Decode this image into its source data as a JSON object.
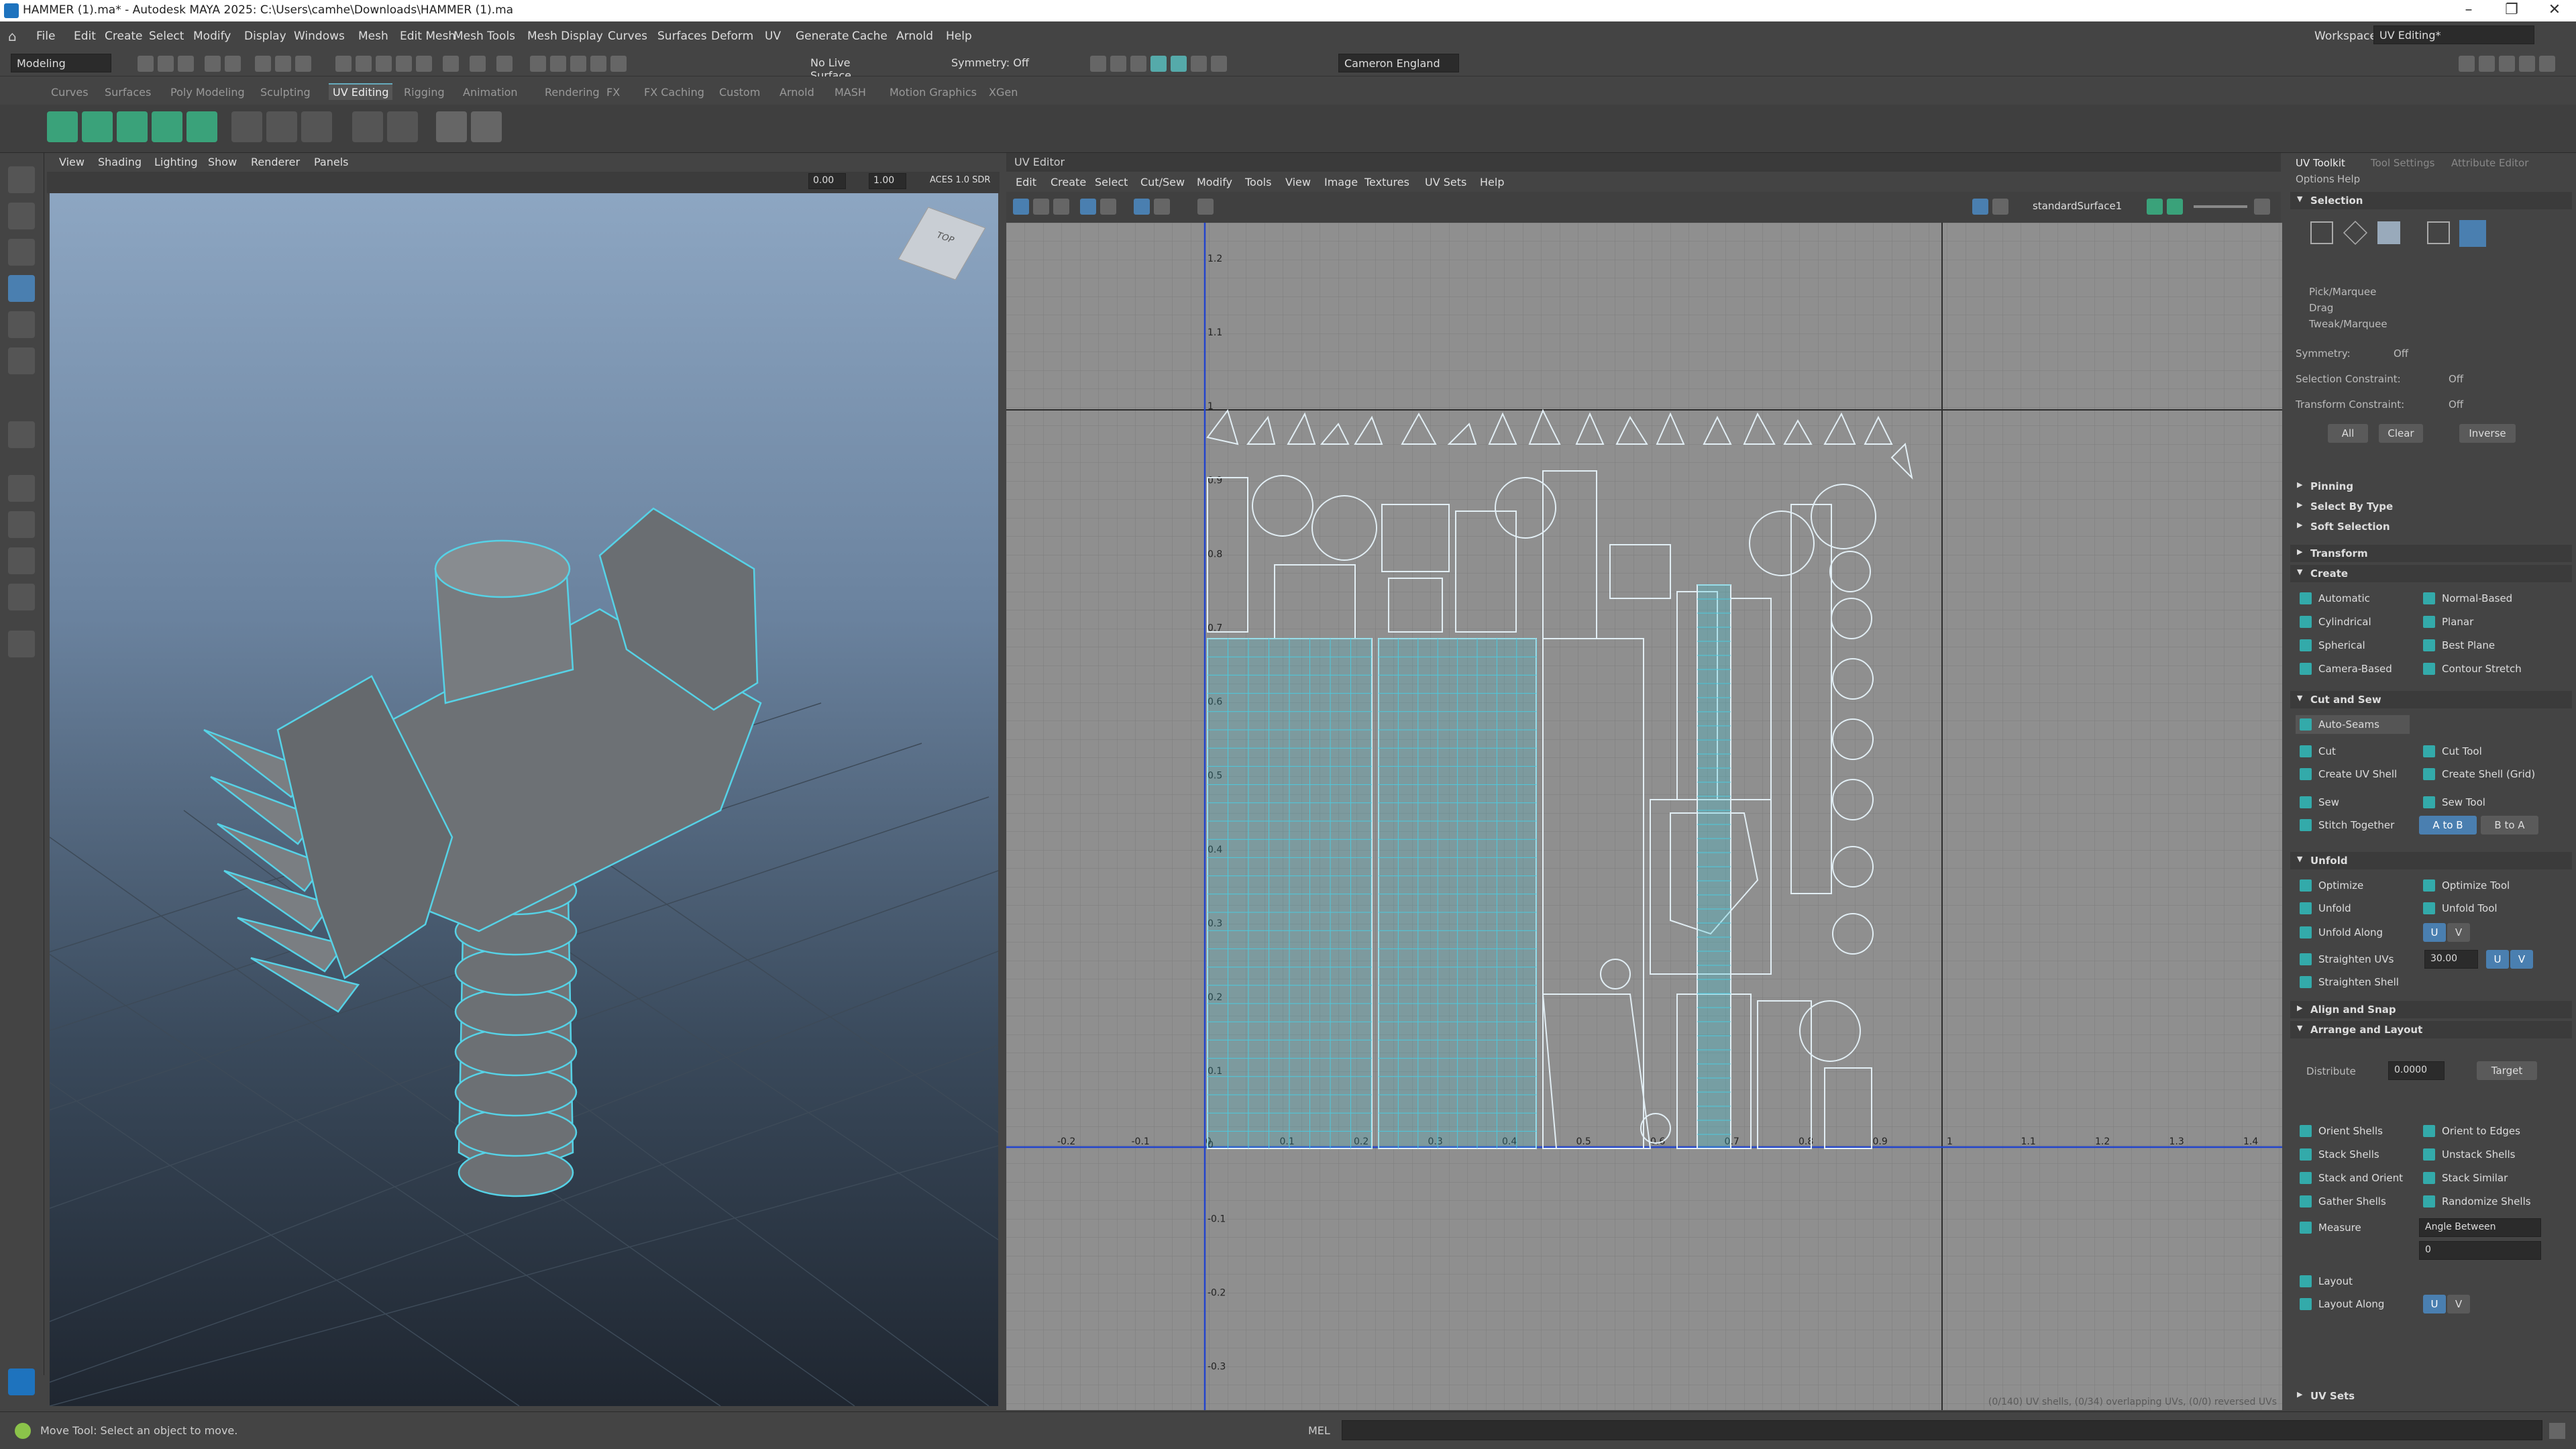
{
  "titlebar": {
    "title": "HAMMER (1).ma* - Autodesk MAYA 2025: C:\\Users\\camhe\\Downloads\\HAMMER (1).ma"
  },
  "menu": [
    "File",
    "Edit",
    "Create",
    "Select",
    "Modify",
    "Display",
    "Windows",
    "Mesh",
    "Edit Mesh",
    "Mesh Tools",
    "Mesh Display",
    "Curves",
    "Surfaces",
    "Deform",
    "UV",
    "Generate",
    "Cache",
    "Arnold",
    "Help"
  ],
  "workspace": {
    "label": "Workspace:",
    "value": "UV Editing*"
  },
  "statusline": {
    "mode": "Modeling",
    "live_surface": "No Live Surface",
    "symmetry": "Symmetry: Off",
    "user": "Cameron England"
  },
  "shelf_tabs": [
    "Curves",
    "Surfaces",
    "Poly Modeling",
    "Sculpting",
    "UV Editing",
    "Rigging",
    "Animation",
    "Rendering",
    "FX",
    "FX Caching",
    "Custom",
    "Arnold",
    "MASH",
    "Motion Graphics",
    "XGen"
  ],
  "shelf_active": "UV Editing",
  "viewport": {
    "menu": [
      "View",
      "Shading",
      "Lighting",
      "Show",
      "Renderer",
      "Panels"
    ],
    "field1": "0.00",
    "field2": "1.00",
    "colorspace": "ACES 1.0 SDR",
    "viewcube": "TOP"
  },
  "uv_editor": {
    "title": "UV Editor",
    "menu": [
      "Edit",
      "Create",
      "Select",
      "Cut/Sew",
      "Modify",
      "Tools",
      "View",
      "Image",
      "Textures",
      "UV Sets",
      "Help"
    ],
    "material": "standardSurface1",
    "status": "(0/140) UV shells, (0/34) overlapping UVs, (0/0) reversed UVs",
    "x_ticks": [
      "-0.2",
      "-0.1",
      "0",
      "0.1",
      "0.2",
      "0.3",
      "0.4",
      "0.5",
      "0.6",
      "0.7",
      "0.8",
      "0.9",
      "1",
      "1.1",
      "1.2",
      "1.3",
      "1.4"
    ],
    "y_ticks": [
      "1.2",
      "1.1",
      "1",
      "0.9",
      "0.8",
      "0.7",
      "0.6",
      "0.5",
      "0.4",
      "0.3",
      "0.2",
      "0.1",
      "0",
      "-0.1",
      "-0.2",
      "-0.3"
    ]
  },
  "uv_toolkit": {
    "tabs": [
      "UV Toolkit",
      "Tool Settings",
      "Attribute Editor"
    ],
    "submenu": [
      "Options",
      "Help"
    ],
    "selection": {
      "title": "Selection",
      "modes": [
        "Pick/Marquee",
        "Drag",
        "Tweak/Marquee"
      ],
      "symmetry_label": "Symmetry:",
      "symmetry_value": "Off",
      "constraint_label": "Selection Constraint:",
      "constraint_value": "Off",
      "transform_label": "Transform Constraint:",
      "transform_value": "Off",
      "buttons": [
        "All",
        "Clear",
        "Inverse"
      ]
    },
    "collapsed": [
      "Pinning",
      "Select By Type",
      "Soft Selection"
    ],
    "transform": "Transform",
    "create": {
      "title": "Create",
      "items": [
        "Automatic",
        "Normal-Based",
        "Cylindrical",
        "Planar",
        "Spherical",
        "Best Plane",
        "Camera-Based",
        "Contour Stretch"
      ]
    },
    "cut_sew": {
      "title": "Cut and Sew",
      "auto": "Auto-Seams",
      "items": [
        "Cut",
        "Cut Tool",
        "Create UV Shell",
        "Create Shell (Grid)",
        "Sew",
        "Sew Tool",
        "Stitch Together"
      ],
      "atob": "A to B",
      "btoa": "B to A"
    },
    "unfold": {
      "title": "Unfold",
      "items": [
        "Optimize",
        "Optimize Tool",
        "Unfold",
        "Unfold Tool",
        "Unfold Along",
        "Straighten UVs",
        "Straighten Shell"
      ],
      "u": "U",
      "v": "V",
      "angle": "30.00"
    },
    "align": "Align and Snap",
    "arrange": {
      "title": "Arrange and Layout",
      "distribute": "Distribute",
      "dist_value": "0.0000",
      "target": "Target",
      "items": [
        "Orient Shells",
        "Orient to Edges",
        "Stack Shells",
        "Unstack Shells",
        "Stack and Orient",
        "Stack Similar",
        "Gather Shells",
        "Randomize Shells"
      ],
      "measure": "Measure",
      "measure_mode": "Angle Between",
      "measure_value": "0",
      "layout": "Layout",
      "layout_along": "Layout Along"
    },
    "uvsets": "UV Sets"
  },
  "cmd": {
    "help": "Move Tool: Select an object to move.",
    "mel": "MEL"
  },
  "colors": {
    "accent": "#5fb8d6",
    "uv_lines": "#d8e8f0",
    "uv_fill": "#3fc4d8"
  }
}
